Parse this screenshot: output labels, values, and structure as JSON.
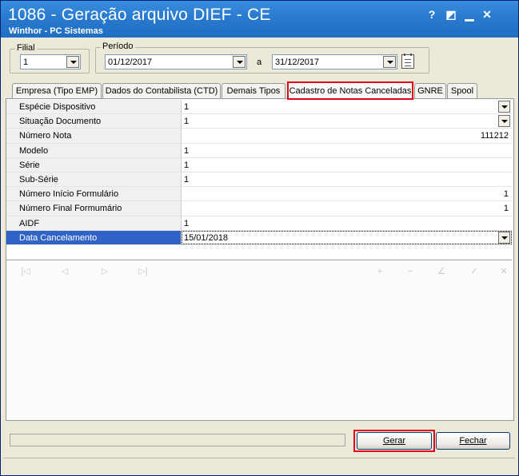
{
  "window": {
    "title": "1086 - Geração arquivo DIEF - CE",
    "subtitle": "Winthor - PC Sistemas",
    "help_label": "?",
    "max_label": "◩",
    "min_label": "▁",
    "close_label": "✕"
  },
  "filial": {
    "label": "Filial",
    "value": "1"
  },
  "periodo": {
    "label": "Período",
    "start": "01/12/2017",
    "separator": "a",
    "end": "31/12/2017"
  },
  "tabs": [
    {
      "label": "Empresa (Tipo EMP)"
    },
    {
      "label": "Dados do Contabilista (CTD)"
    },
    {
      "label": "Demais Tipos"
    },
    {
      "label": "Cadastro de Notas Canceladas"
    },
    {
      "label": "GNRE"
    },
    {
      "label": "Spool"
    }
  ],
  "grid": {
    "rows": [
      {
        "label": "Espécie Dispositivo",
        "value": "1"
      },
      {
        "label": "Situação Documento",
        "value": "1"
      },
      {
        "label": "Número Nota",
        "value": "111212"
      },
      {
        "label": "Modelo",
        "value": "1"
      },
      {
        "label": "Série",
        "value": "1"
      },
      {
        "label": "Sub-Série",
        "value": "1"
      },
      {
        "label": "Número Início Formulário",
        "value": "1"
      },
      {
        "label": "Número Final Formumário",
        "value": "1"
      },
      {
        "label": "AIDF",
        "value": "1"
      },
      {
        "label": "Data Cancelamento",
        "value": "15/01/2018"
      }
    ]
  },
  "navigator": {
    "first": "|◁",
    "prev": "◁",
    "next": "▷",
    "last": "▷|",
    "insert": "+",
    "delete": "−",
    "edit": "∠",
    "post": "✓",
    "cancel": "✕"
  },
  "buttons": {
    "gerar": "Gerar",
    "fechar": "Fechar"
  },
  "colors": {
    "titlebar": "#2a7cd0",
    "highlight": "#e2001a",
    "selected_row": "#3163c6"
  }
}
